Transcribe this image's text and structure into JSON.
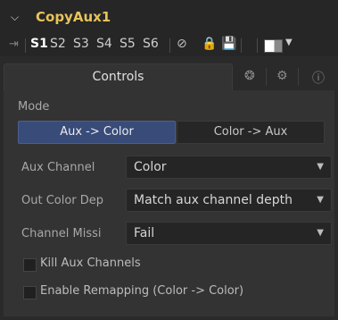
{
  "header": {
    "title": "CopyAux1"
  },
  "versions": [
    "S1",
    "S2",
    "S3",
    "S4",
    "S5",
    "S6"
  ],
  "tabs": {
    "controls_label": "Controls"
  },
  "mode": {
    "label": "Mode",
    "options": [
      "Aux -> Color",
      "Color -> Aux"
    ],
    "selected": "Aux -> Color"
  },
  "fields": {
    "aux_channel": {
      "label": "Aux Channel",
      "value": "Color"
    },
    "out_color_depth": {
      "label": "Out Color Dep",
      "value": "Match aux channel depth"
    },
    "channel_missing": {
      "label": "Channel Missi",
      "value": "Fail"
    }
  },
  "checkboxes": {
    "kill_aux": "Kill Aux Channels",
    "enable_remap": "Enable Remapping (Color -> Color)"
  }
}
